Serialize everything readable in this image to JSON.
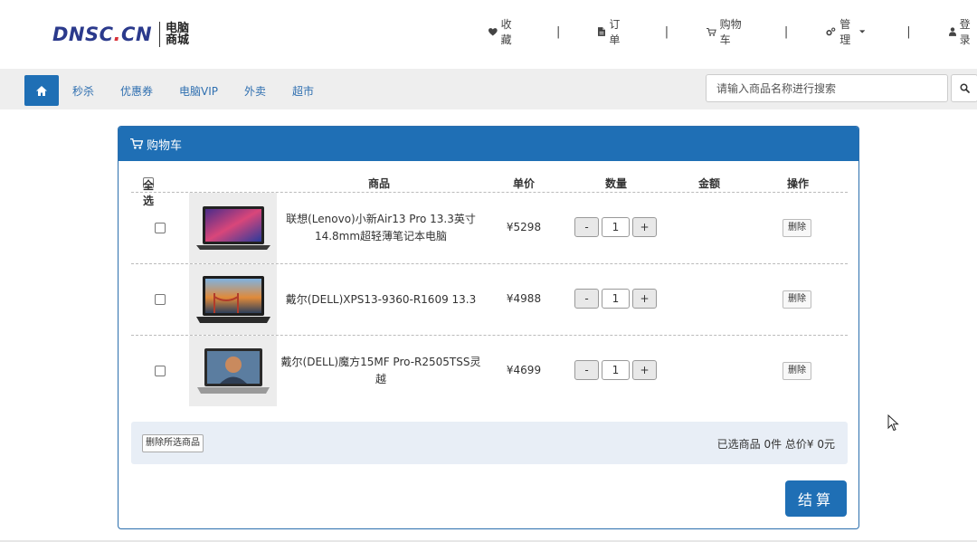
{
  "brand": {
    "logo_main": "DNSC",
    "logo_dot": ".",
    "logo_tld": "CN",
    "logo_sub": "电脑商城"
  },
  "topnav": {
    "favorites": "收藏",
    "orders": "订单",
    "cart": "购物车",
    "manage": "管理",
    "login": "登录",
    "separator": "|"
  },
  "catbar": {
    "links": [
      "秒杀",
      "优惠券",
      "电脑VIP",
      "外卖",
      "超市"
    ],
    "search_placeholder": "请输入商品名称进行搜索"
  },
  "panel": {
    "title": "购物车"
  },
  "table": {
    "headers": {
      "select_all": "全选",
      "product": "商品",
      "unit_price": "单价",
      "quantity": "数量",
      "amount": "金额",
      "action": "操作"
    },
    "rows": [
      {
        "name": "联想(Lenovo)小新Air13 Pro 13.3英寸14.8mm超轻薄笔记本电脑",
        "price": "¥5298",
        "qty": "1",
        "amount": "",
        "delete": "删除",
        "minus": "-",
        "plus": "+"
      },
      {
        "name": "戴尔(DELL)XPS13-9360-R1609 13.3",
        "price": "¥4988",
        "qty": "1",
        "amount": "",
        "delete": "删除",
        "minus": "-",
        "plus": "+"
      },
      {
        "name": "戴尔(DELL)魔方15MF Pro-R2505TSS灵越",
        "price": "¥4699",
        "qty": "1",
        "amount": "",
        "delete": "删除",
        "minus": "-",
        "plus": "+"
      }
    ]
  },
  "footer": {
    "delete_selected": "删除所选商品",
    "summary": "已选商品 0件 总价¥ 0元",
    "checkout": "结算"
  },
  "colors": {
    "primary": "#1f6fb5",
    "link": "#2f6fb0",
    "logo_blue": "#2b3a8c",
    "logo_red": "#d8323a"
  }
}
